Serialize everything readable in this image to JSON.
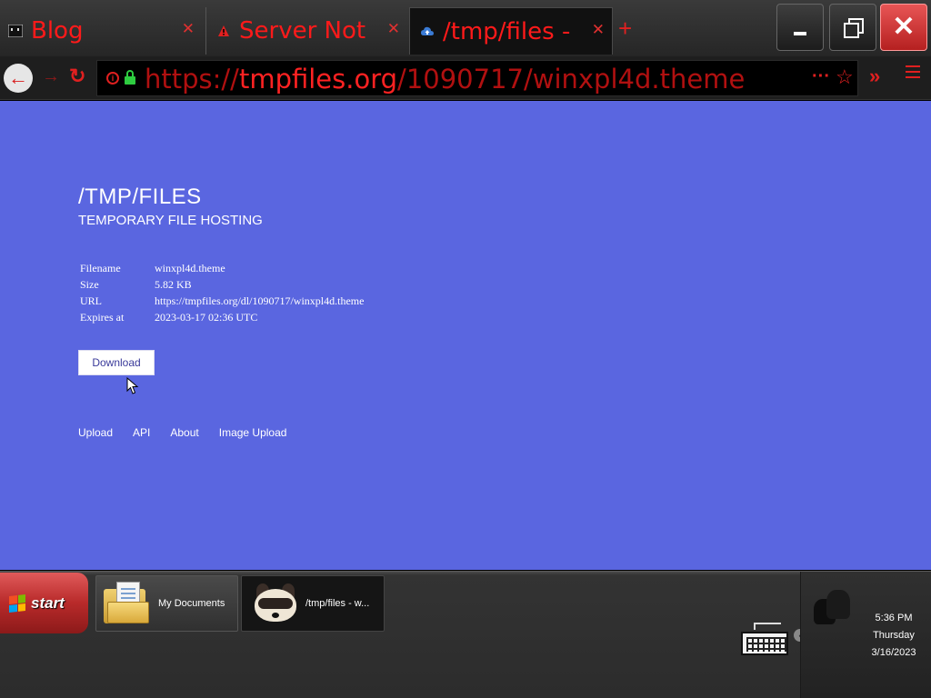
{
  "browser": {
    "tabs": [
      {
        "title": "Blog",
        "active": false
      },
      {
        "title": "Server Not",
        "active": false
      },
      {
        "title": "/tmp/files -",
        "active": true
      }
    ],
    "new_tab_label": "+",
    "url_scheme": "https://",
    "url_host": "tmpfiles.org",
    "url_path": "/1090717/winxpl4d.theme",
    "accent_color": "#ff2222"
  },
  "page": {
    "title": "/TMP/FILES",
    "subtitle": "TEMPORARY FILE HOSTING",
    "file_info": [
      {
        "key": "Filename",
        "value": "winxpl4d.theme"
      },
      {
        "key": "Size",
        "value": "5.82 KB"
      },
      {
        "key": "URL",
        "value": "https://tmpfiles.org/dl/1090717/winxpl4d.theme"
      },
      {
        "key": "Expires at",
        "value": "2023-03-17 02:36 UTC"
      }
    ],
    "download_label": "Download",
    "footer_links": [
      "Upload",
      "API",
      "About",
      "Image Upload"
    ],
    "background_color": "#5a66e0"
  },
  "taskbar": {
    "start_label": "start",
    "tasks": [
      {
        "label": "My Documents"
      },
      {
        "label": "/tmp/files - w..."
      }
    ],
    "clock": {
      "time": "5:36 PM",
      "day": "Thursday",
      "date": "3/16/2023"
    }
  }
}
